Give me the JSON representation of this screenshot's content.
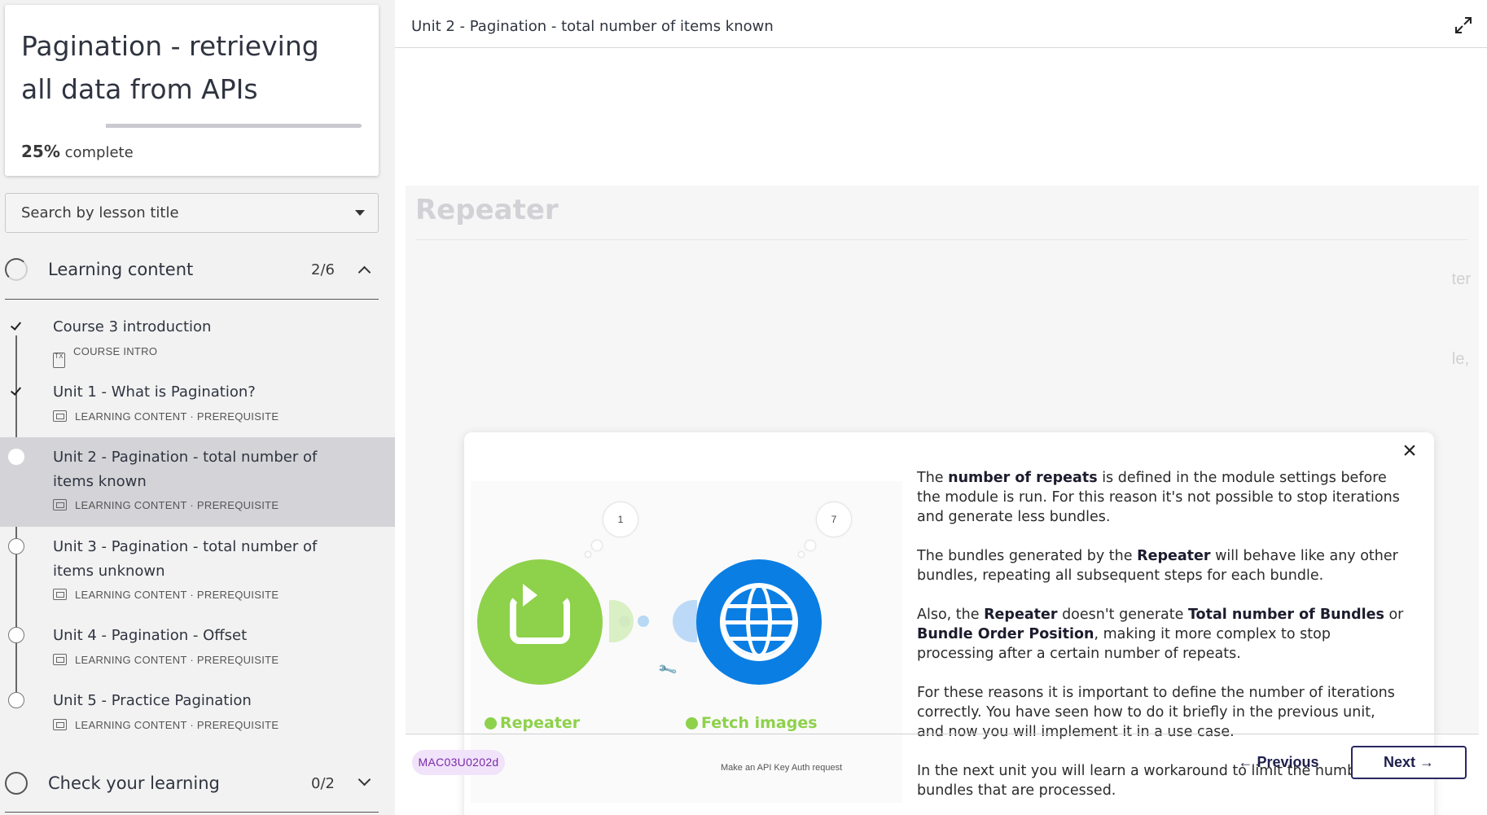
{
  "course": {
    "title": "Pagination - retrieving all data from APIs",
    "progress_percent": 25,
    "progress_value": "25%",
    "progress_suffix": "complete"
  },
  "search": {
    "label": "Search by lesson title"
  },
  "sections": [
    {
      "title": "Learning content",
      "count": "2/6",
      "expanded": true
    },
    {
      "title": "Check your learning",
      "count": "0/2",
      "expanded": false
    }
  ],
  "lessons": [
    {
      "title": "Course 3 introduction",
      "meta": "COURSE INTRO",
      "status": "done"
    },
    {
      "title": "Unit 1 - What is Pagination?",
      "meta": "LEARNING CONTENT · PREREQUISITE",
      "status": "done"
    },
    {
      "title": "Unit 2 - Pagination - total number of items known",
      "meta": "LEARNING CONTENT · PREREQUISITE",
      "status": "current"
    },
    {
      "title": "Unit 3 - Pagination - total number of items unknown",
      "meta": "LEARNING CONTENT · PREREQUISITE",
      "status": "todo"
    },
    {
      "title": "Unit 4 - Pagination - Offset",
      "meta": "LEARNING CONTENT · PREREQUISITE",
      "status": "todo"
    },
    {
      "title": "Unit 5 - Practice Pagination",
      "meta": "LEARNING CONTENT · PREREQUISITE",
      "status": "todo"
    }
  ],
  "main": {
    "header_title": "Unit 2 - Pagination - total number of items known",
    "ghost_heading": "Repeater",
    "ghost_right_1": "ter",
    "ghost_right_2": "le,",
    "lesson_code": "MAC03U0202d",
    "previous_label": "← Previous",
    "next_label": "Next →"
  },
  "modal": {
    "close_glyph": "×",
    "illustration": {
      "bubble_left_num": "1",
      "bubble_right_num": "7",
      "module_left_label": "Repeater",
      "module_right_label": "Fetch images",
      "module_right_sub": "Make an API Key Auth request",
      "colors": {
        "repeater": "#8ed14b",
        "http": "#0a7ee3"
      }
    },
    "p1_a": "The ",
    "p1_b": "number of repeats",
    "p1_c": " is defined in the module settings before the module is run. For this reason it's not possible to stop iterations and generate less bundles.",
    "p2_a": "The bundles generated by the ",
    "p2_b": "Repeater",
    "p2_c": " will behave like any other bundles, repeating all subsequent steps for each bundle.",
    "p3_a": "Also, the ",
    "p3_b": "Repeater",
    "p3_c": " doesn't generate ",
    "p3_d": "Total number of Bundles",
    "p3_e": " or ",
    "p3_f": "Bundle Order Position",
    "p3_g": ", making it more complex to stop processing after a certain number of repeats.",
    "p4": "For these reasons it is important to define the number of iterations correctly. You have seen how to do it briefly in the previous unit, and now you will implement it in a use case.",
    "p5": "In the next unit you will learn a workaround to limit the number of bundles that are processed."
  }
}
